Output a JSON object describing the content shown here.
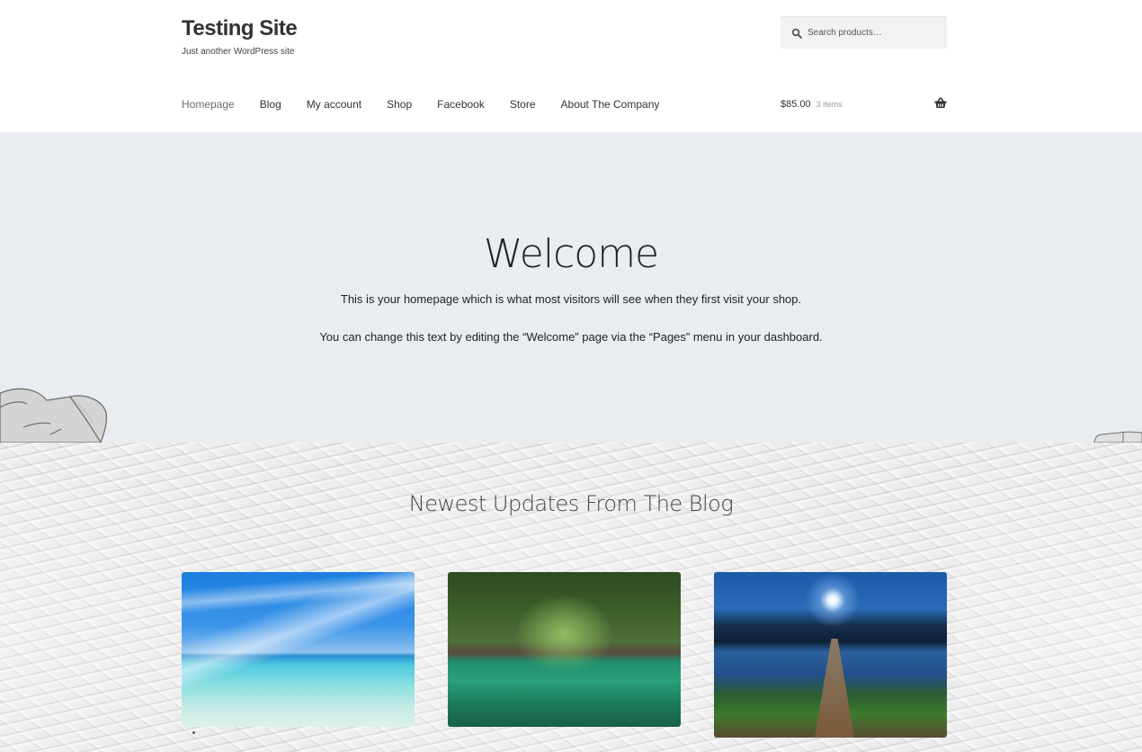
{
  "header": {
    "site_title": "Testing Site",
    "tagline": "Just another WordPress site",
    "search": {
      "placeholder": "Search products…",
      "value": "",
      "icon": "search-icon"
    },
    "nav": [
      {
        "label": "Homepage",
        "current": true
      },
      {
        "label": "Blog",
        "current": false
      },
      {
        "label": "My account",
        "current": false
      },
      {
        "label": "Shop",
        "current": false
      },
      {
        "label": "Facebook",
        "current": false
      },
      {
        "label": "Store",
        "current": false
      },
      {
        "label": "About The Company",
        "current": false
      }
    ],
    "cart": {
      "amount": "$85.00",
      "count": "3 items",
      "icon": "basket-icon"
    }
  },
  "hero": {
    "title": "Welcome",
    "paragraphs": [
      "This is your homepage which is what most visitors will see when they first visit your shop.",
      "You can change this text by editing the “Welcome” page via the “Pages” menu in your dashboard."
    ],
    "decorations": [
      "hoodie-image-left",
      "hoodie-image-right"
    ]
  },
  "blog": {
    "heading": "Newest Updates From The Blog",
    "posts": [
      {
        "image": "tropical-beach-sky"
      },
      {
        "image": "forest-river"
      },
      {
        "image": "moonlit-lake-dock"
      }
    ]
  },
  "colors": {
    "hero_background": "#e9edf1",
    "text_dark": "#333333",
    "search_background": "#f2f2f2"
  }
}
